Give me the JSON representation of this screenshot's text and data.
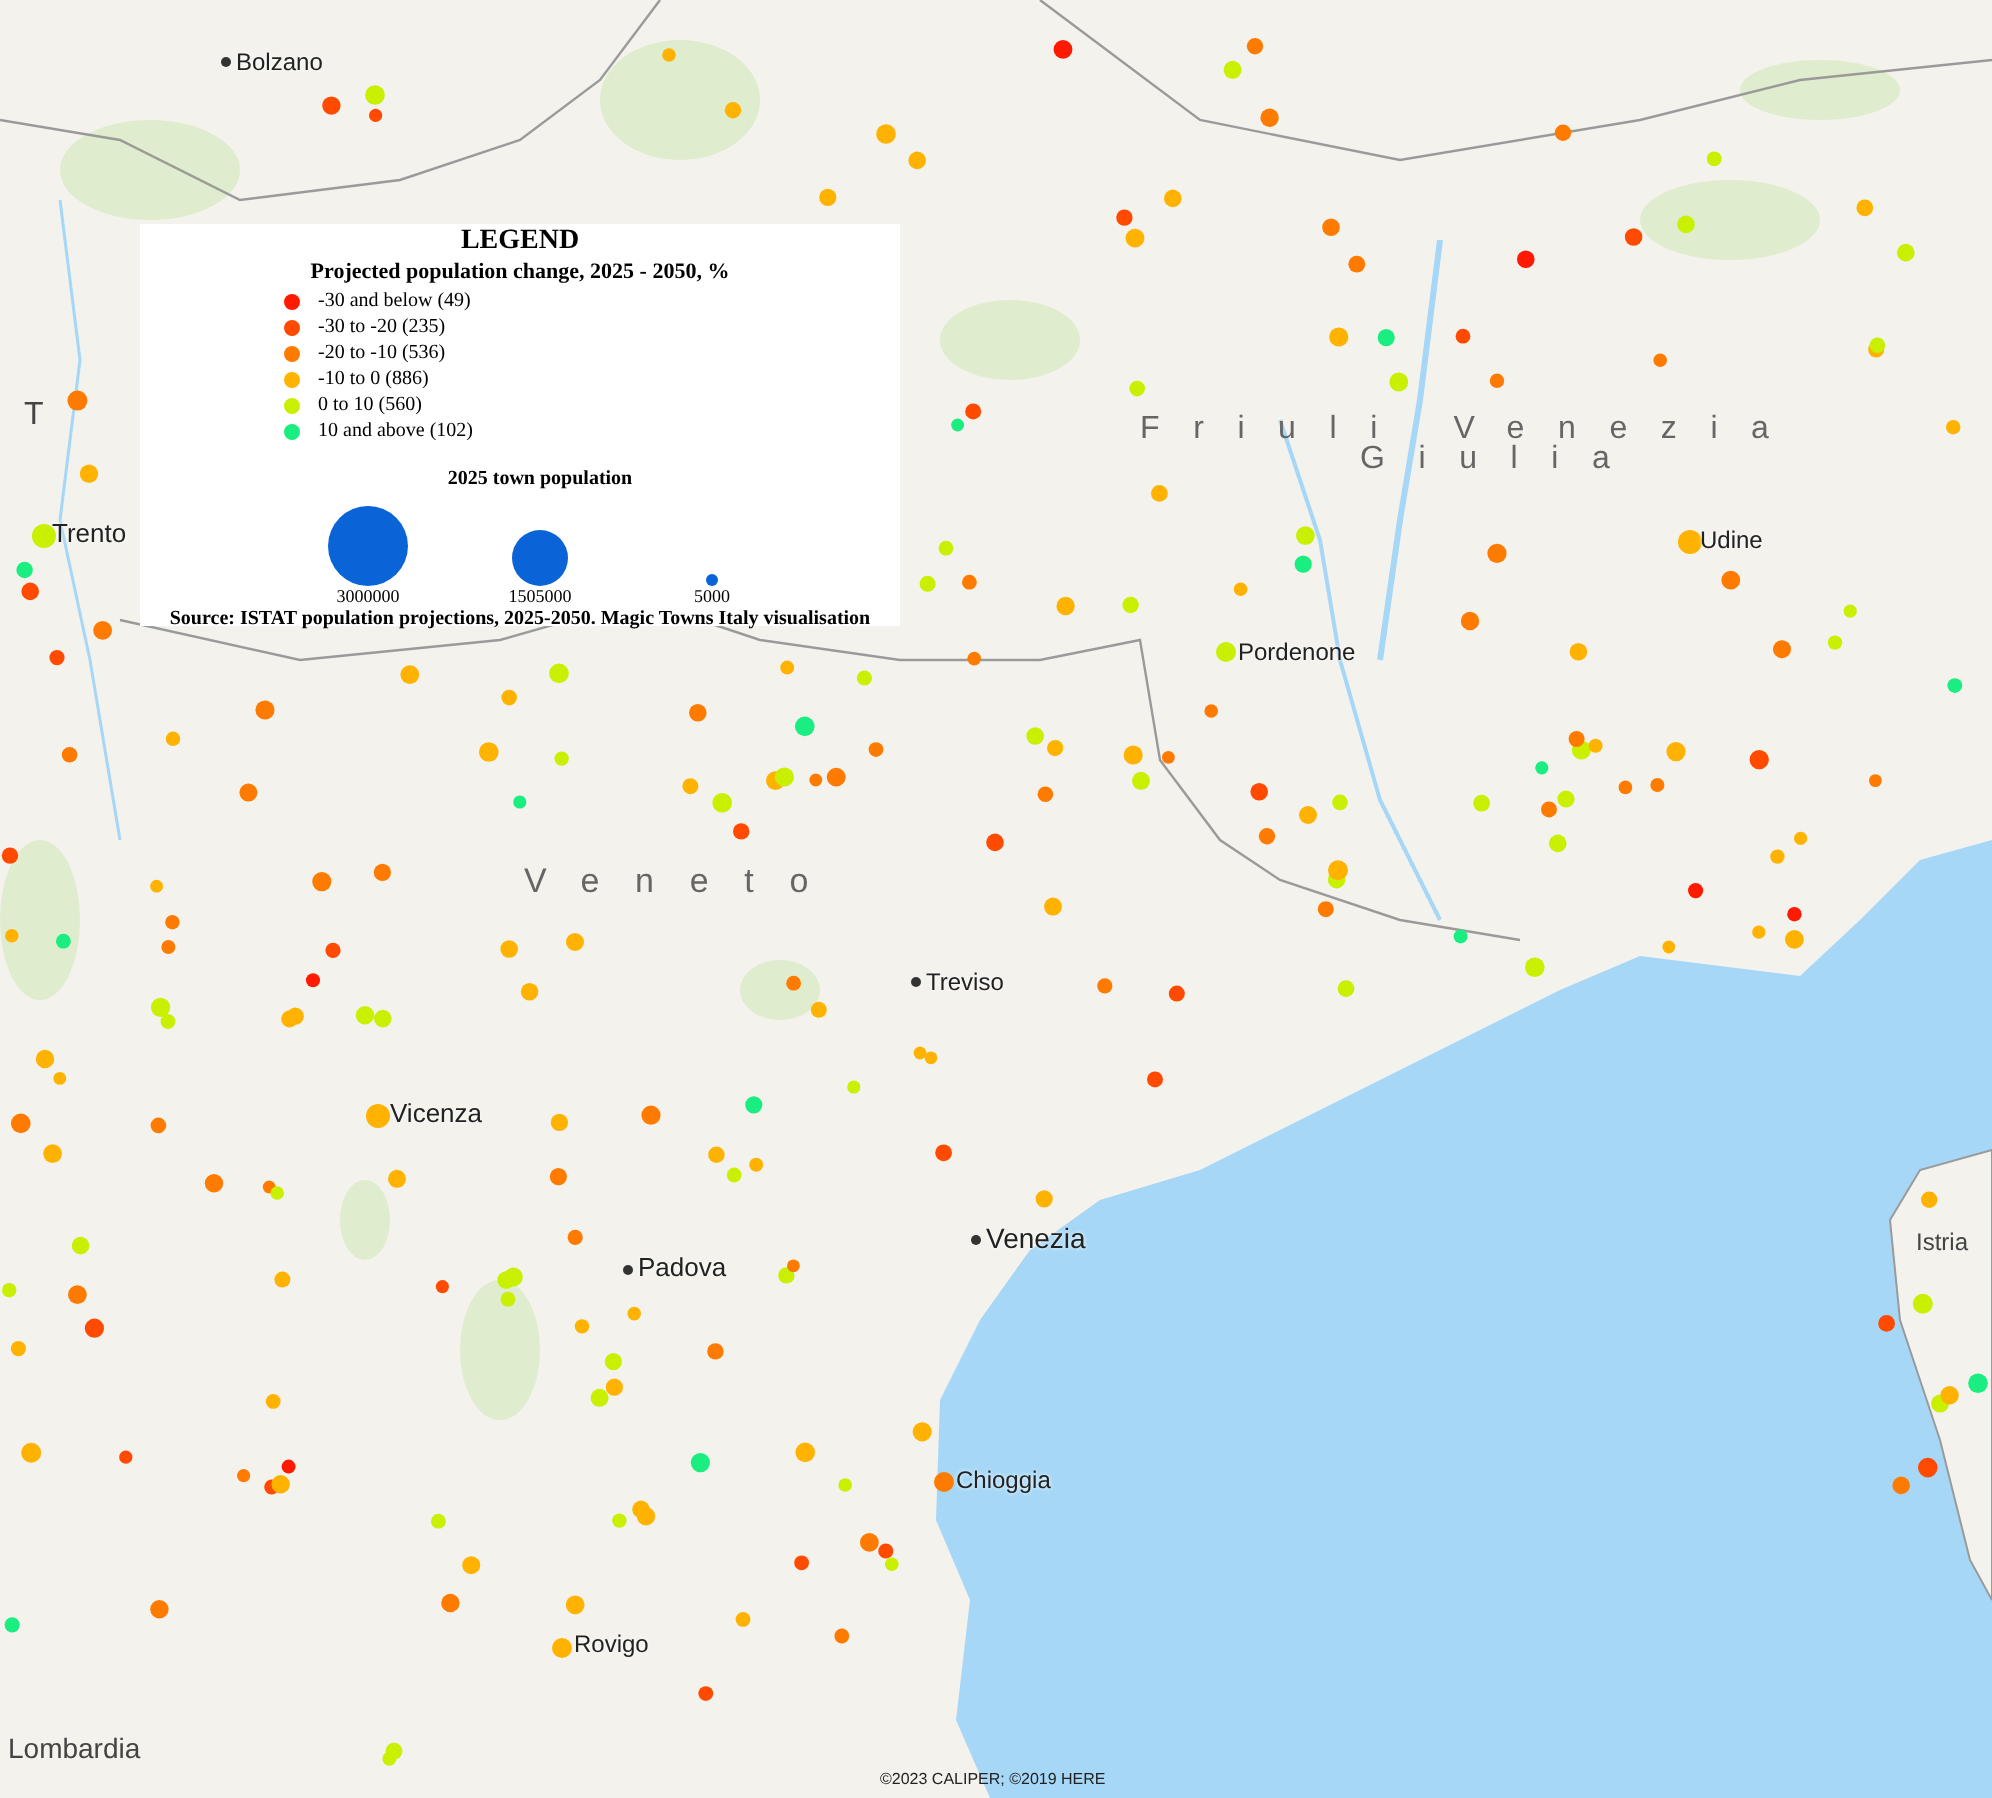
{
  "map": {
    "regions": [
      {
        "name": "T",
        "kind": "plain"
      },
      {
        "name": "Friuli Venezia",
        "kind": "spaced"
      },
      {
        "name": "Giulia",
        "kind": "spaced"
      },
      {
        "name": "Veneto",
        "kind": "spaced"
      },
      {
        "name": "Istria",
        "kind": "plain"
      },
      {
        "name": "Lombardia",
        "kind": "plain"
      }
    ],
    "cities": [
      {
        "name": "Bolzano",
        "color": "#333333"
      },
      {
        "name": "Trento",
        "color": "#c8f000"
      },
      {
        "name": "Pordenone",
        "color": "#c8f000"
      },
      {
        "name": "Udine",
        "color": "#ffb300"
      },
      {
        "name": "Treviso",
        "color": "#333333"
      },
      {
        "name": "Vicenza",
        "color": "#ffb300"
      },
      {
        "name": "Venezia",
        "color": "#333333"
      },
      {
        "name": "Padova",
        "color": "#333333"
      },
      {
        "name": "Chioggia",
        "color": "#ff7b00"
      },
      {
        "name": "Rovigo",
        "color": "#ffb300"
      }
    ],
    "credit": "©2023 CALIPER; ©2019 HERE"
  },
  "legend": {
    "title": "LEGEND",
    "subtitle": "Projected population change, 2025 - 2050, %",
    "classes": [
      {
        "label": "-30 and below (49)",
        "color": "#ff1a00"
      },
      {
        "label": "-30 to -20 (235)",
        "color": "#ff4a00"
      },
      {
        "label": "-20 to -10 (536)",
        "color": "#ff7b00"
      },
      {
        "label": "-10 to 0 (886)",
        "color": "#ffb300"
      },
      {
        "label": "0 to 10 (560)",
        "color": "#c8f000"
      },
      {
        "label": "10 and above (102)",
        "color": "#1aee80"
      }
    ],
    "size_title": "2025 town population",
    "sizes": [
      {
        "label": "3000000",
        "kind": "large"
      },
      {
        "label": "1505000",
        "kind": "medium"
      },
      {
        "label": "5000",
        "kind": "small"
      }
    ],
    "source": "Source: ISTAT population projections, 2025-2050. Magic Towns Italy visualisation"
  }
}
